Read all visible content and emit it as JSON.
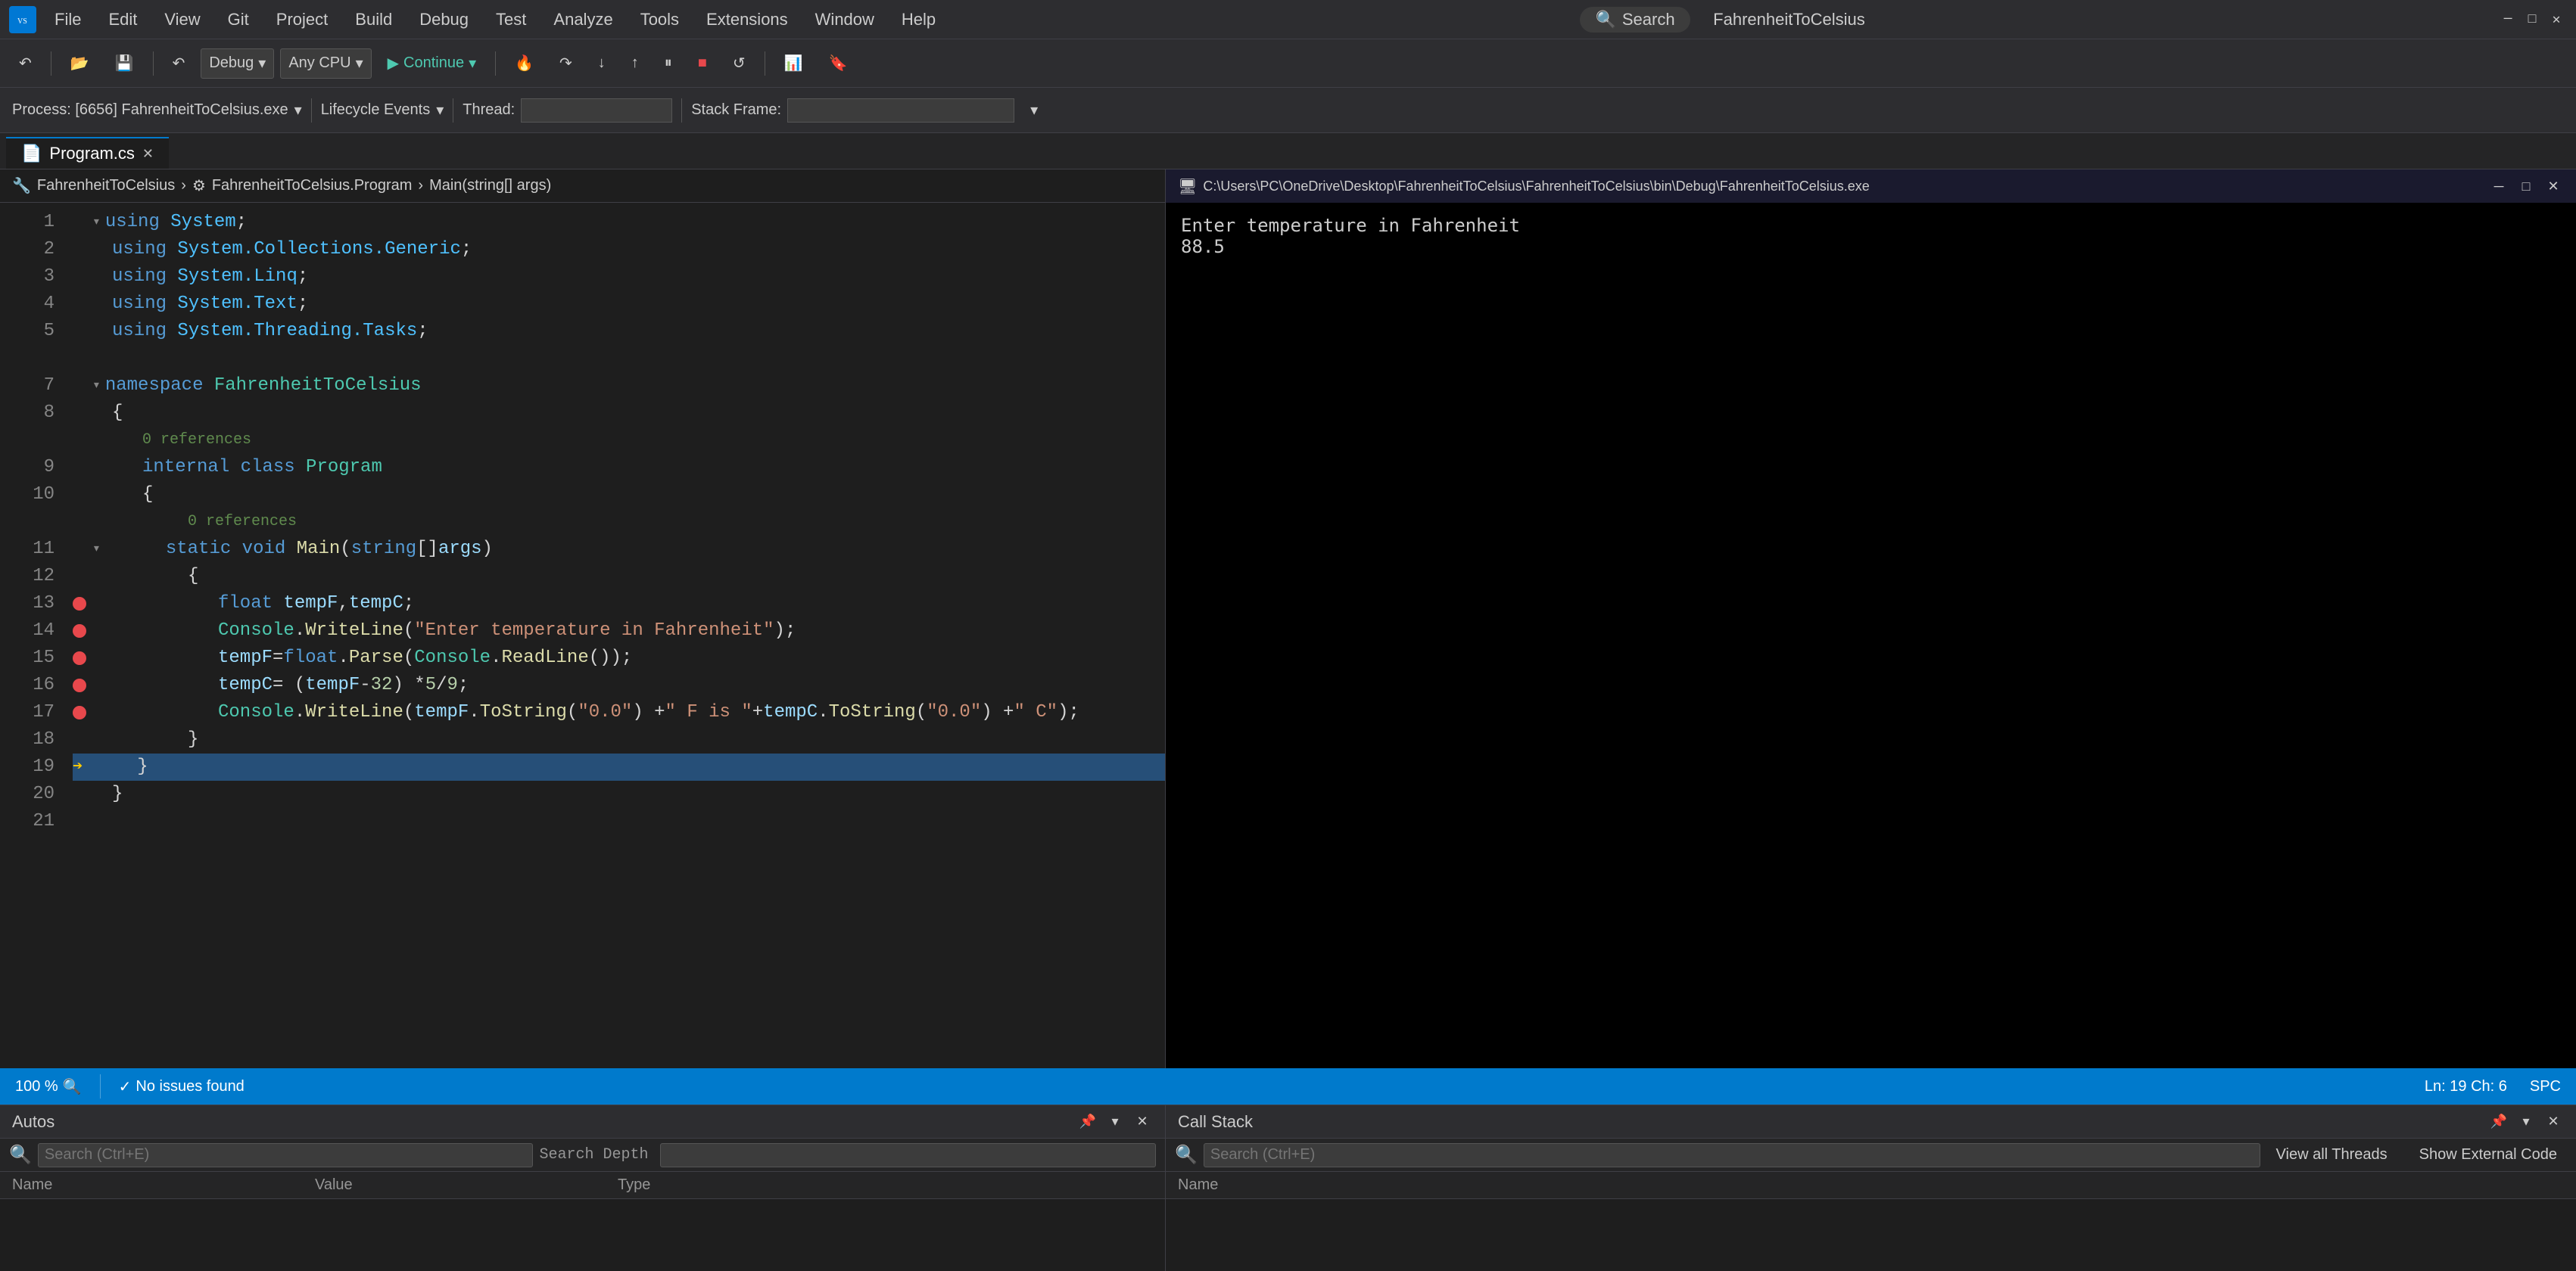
{
  "app": {
    "title": "FahrenheitToCelsius",
    "window_icon": "VS"
  },
  "menu": {
    "items": [
      "File",
      "Edit",
      "View",
      "Git",
      "Project",
      "Build",
      "Debug",
      "Test",
      "Analyze",
      "Tools",
      "Extensions",
      "Window",
      "Help"
    ]
  },
  "toolbar": {
    "debug_config": "Debug",
    "platform": "Any CPU",
    "continue_label": "Continue",
    "process_label": "Process: [6656] FahrenheitToCelsius.exe",
    "lifecycle_label": "Lifecycle Events",
    "thread_label": "Thread:",
    "stack_frame_label": "Stack Frame:"
  },
  "tabs": [
    {
      "label": "Program.cs",
      "active": true,
      "modified": false
    },
    {
      "label": "×",
      "is_close": true
    }
  ],
  "breadcrumb": {
    "file": "FahrenheitToCelsius",
    "separator": "›",
    "class": "FahrenheitToCelsius.Program",
    "method": "Main(string[] args)"
  },
  "code": {
    "lines": [
      {
        "num": 1,
        "text": "using System;",
        "tokens": [
          {
            "type": "kw-using",
            "val": "using"
          },
          {
            "type": "text",
            "val": " "
          },
          {
            "type": "ns-name",
            "val": "System"
          },
          {
            "type": "text",
            "val": ";"
          }
        ]
      },
      {
        "num": 2,
        "text": "using System.Collections.Generic;",
        "tokens": [
          {
            "type": "kw-using",
            "val": "using"
          },
          {
            "type": "text",
            "val": " "
          },
          {
            "type": "ns-name",
            "val": "System.Collections.Generic"
          },
          {
            "type": "text",
            "val": ";"
          }
        ]
      },
      {
        "num": 3,
        "text": "using System.Linq;",
        "tokens": [
          {
            "type": "kw-using",
            "val": "using"
          },
          {
            "type": "text",
            "val": " "
          },
          {
            "type": "ns-name",
            "val": "System.Linq"
          },
          {
            "type": "text",
            "val": ";"
          }
        ]
      },
      {
        "num": 4,
        "text": "using System.Text;",
        "tokens": [
          {
            "type": "kw-using",
            "val": "using"
          },
          {
            "type": "text",
            "val": " "
          },
          {
            "type": "ns-name",
            "val": "System.Text"
          },
          {
            "type": "text",
            "val": ";"
          }
        ]
      },
      {
        "num": 5,
        "text": "using System.Threading.Tasks;",
        "tokens": [
          {
            "type": "kw-using",
            "val": "using"
          },
          {
            "type": "text",
            "val": " "
          },
          {
            "type": "ns-name",
            "val": "System.Threading.Tasks"
          },
          {
            "type": "text",
            "val": ";"
          }
        ]
      },
      {
        "num": 6,
        "text": "",
        "tokens": []
      },
      {
        "num": 7,
        "text": "namespace FahrenheitToCelsius",
        "tokens": [
          {
            "type": "kw-namespace",
            "val": "namespace"
          },
          {
            "type": "text",
            "val": " "
          },
          {
            "type": "class-name",
            "val": "FahrenheitToCelsius"
          }
        ]
      },
      {
        "num": 8,
        "text": "{",
        "tokens": [
          {
            "type": "text",
            "val": "{"
          }
        ]
      },
      {
        "num": 9,
        "text": "    0 references",
        "tokens": [
          {
            "type": "comment-ref",
            "val": "    0 references"
          }
        ]
      },
      {
        "num": 9,
        "text": "    internal class Program",
        "tokens": [
          {
            "type": "text",
            "val": "    "
          },
          {
            "type": "kw-internal",
            "val": "internal"
          },
          {
            "type": "text",
            "val": " "
          },
          {
            "type": "kw-class",
            "val": "class"
          },
          {
            "type": "text",
            "val": " "
          },
          {
            "type": "class-name",
            "val": "Program"
          }
        ],
        "linenum": 9
      },
      {
        "num": 10,
        "text": "    {",
        "tokens": [
          {
            "type": "text",
            "val": "    {"
          }
        ]
      },
      {
        "num": 11,
        "text": "        0 references",
        "tokens": [
          {
            "type": "comment-ref",
            "val": "        0 references"
          }
        ]
      },
      {
        "num": 11,
        "text": "        static void Main(string[] args)",
        "tokens": [
          {
            "type": "text",
            "val": "        "
          },
          {
            "type": "kw-static",
            "val": "static"
          },
          {
            "type": "text",
            "val": " "
          },
          {
            "type": "kw-void",
            "val": "void"
          },
          {
            "type": "text",
            "val": " "
          },
          {
            "type": "method-name",
            "val": "Main"
          },
          {
            "type": "text",
            "val": "("
          },
          {
            "type": "kw-string",
            "val": "string"
          },
          {
            "type": "text",
            "val": "[] "
          },
          {
            "type": "param",
            "val": "args"
          },
          {
            "type": "text",
            "val": ")"
          }
        ],
        "linenum": 11
      },
      {
        "num": 12,
        "text": "        {",
        "tokens": [
          {
            "type": "text",
            "val": "        {"
          }
        ]
      },
      {
        "num": 13,
        "text": "            float tempF, tempC;",
        "tokens": [
          {
            "type": "text",
            "val": "            "
          },
          {
            "type": "kw-float",
            "val": "float"
          },
          {
            "type": "text",
            "val": " "
          },
          {
            "type": "var-name",
            "val": "tempF"
          },
          {
            "type": "text",
            "val": ", "
          },
          {
            "type": "var-name",
            "val": "tempC"
          },
          {
            "type": "text",
            "val": ";"
          }
        ],
        "breakpoint": true
      },
      {
        "num": 14,
        "text": "            Console.WriteLine(\"Enter temperature in Fahrenheit\");",
        "tokens": [
          {
            "type": "text",
            "val": "            "
          },
          {
            "type": "class-name",
            "val": "Console"
          },
          {
            "type": "text",
            "val": "."
          },
          {
            "type": "method-name",
            "val": "WriteLine"
          },
          {
            "type": "text",
            "val": "("
          },
          {
            "type": "string-lit",
            "val": "\"Enter temperature in Fahrenheit\""
          },
          {
            "type": "text",
            "val": ");"
          }
        ],
        "breakpoint": true
      },
      {
        "num": 15,
        "text": "            tempF=float.Parse(Console.ReadLine());",
        "tokens": [
          {
            "type": "text",
            "val": "            "
          },
          {
            "type": "var-name",
            "val": "tempF"
          },
          {
            "type": "text",
            "val": "="
          },
          {
            "type": "kw-float",
            "val": "float"
          },
          {
            "type": "text",
            "val": "."
          },
          {
            "type": "method-name",
            "val": "Parse"
          },
          {
            "type": "text",
            "val": "("
          },
          {
            "type": "class-name",
            "val": "Console"
          },
          {
            "type": "text",
            "val": "."
          },
          {
            "type": "method-name",
            "val": "ReadLine"
          },
          {
            "type": "text",
            "val": "());"
          }
        ],
        "breakpoint": true
      },
      {
        "num": 16,
        "text": "            tempC = (tempF - 32) * 5 / 9;",
        "tokens": [
          {
            "type": "text",
            "val": "            "
          },
          {
            "type": "var-name",
            "val": "tempC"
          },
          {
            "type": "text",
            "val": " = ("
          },
          {
            "type": "var-name",
            "val": "tempF"
          },
          {
            "type": "text",
            "val": " - "
          },
          {
            "type": "number-lit",
            "val": "32"
          },
          {
            "type": "text",
            "val": ") * "
          },
          {
            "type": "number-lit",
            "val": "5"
          },
          {
            "type": "text",
            "val": " / "
          },
          {
            "type": "number-lit",
            "val": "9"
          },
          {
            "type": "text",
            "val": ";"
          }
        ],
        "breakpoint": true
      },
      {
        "num": 17,
        "text": "            Console.WriteLine(tempF.ToString(\"0.0\") + \" F is \" + tempC.ToString(\"0.0\") + \" C\");",
        "tokens": [
          {
            "type": "text",
            "val": "            "
          },
          {
            "type": "class-name",
            "val": "Console"
          },
          {
            "type": "text",
            "val": "."
          },
          {
            "type": "method-name",
            "val": "WriteLine"
          },
          {
            "type": "text",
            "val": "("
          },
          {
            "type": "var-name",
            "val": "tempF"
          },
          {
            "type": "text",
            "val": "."
          },
          {
            "type": "method-name",
            "val": "ToString"
          },
          {
            "type": "text",
            "val": "("
          },
          {
            "type": "string-lit",
            "val": "\"0.0\""
          },
          {
            "type": "text",
            "val": ") + "
          },
          {
            "type": "string-lit",
            "val": "\" F is \""
          },
          {
            "type": "text",
            "val": " + "
          },
          {
            "type": "var-name",
            "val": "tempC"
          },
          {
            "type": "text",
            "val": "."
          },
          {
            "type": "method-name",
            "val": "ToString"
          },
          {
            "type": "text",
            "val": "("
          },
          {
            "type": "string-lit",
            "val": "\"0.0\""
          },
          {
            "type": "text",
            "val": ") + "
          },
          {
            "type": "string-lit",
            "val": "\" C\""
          },
          {
            "type": "text",
            "val": ");"
          }
        ],
        "breakpoint": true
      },
      {
        "num": 18,
        "text": "        }",
        "tokens": [
          {
            "type": "text",
            "val": "        }"
          }
        ]
      },
      {
        "num": 19,
        "text": "    }",
        "tokens": [
          {
            "type": "text",
            "val": "    }"
          }
        ],
        "current": true
      },
      {
        "num": 20,
        "text": "}",
        "tokens": [
          {
            "type": "text",
            "val": "}"
          }
        ]
      },
      {
        "num": 21,
        "text": "",
        "tokens": []
      }
    ]
  },
  "console": {
    "title_path": "C:\\Users\\PC\\OneDrive\\Desktop\\FahrenheitToCelsius\\FahrenheitToCelsius\\bin\\Debug\\FahrenheitToCelsius.exe",
    "output_line1": "Enter temperature in Fahrenheit",
    "output_line2": "88.5"
  },
  "status_bar": {
    "zoom": "100 %",
    "issues": "No issues found",
    "location": "Ln: 19   Ch: 6",
    "encoding": "SPC"
  },
  "autos_panel": {
    "title": "Autos",
    "search_placeholder": "Search (Ctrl+E)",
    "search_depth_label": "Search Depth",
    "columns": [
      "Name",
      "Value",
      "Type"
    ]
  },
  "call_stack_panel": {
    "title": "Call Stack",
    "search_placeholder": "Search (Ctrl+E)",
    "view_threads_label": "View all Threads",
    "show_external_label": "Show External Code",
    "columns": [
      "Name"
    ]
  },
  "search": {
    "label": "Search",
    "icon": "🔍"
  }
}
